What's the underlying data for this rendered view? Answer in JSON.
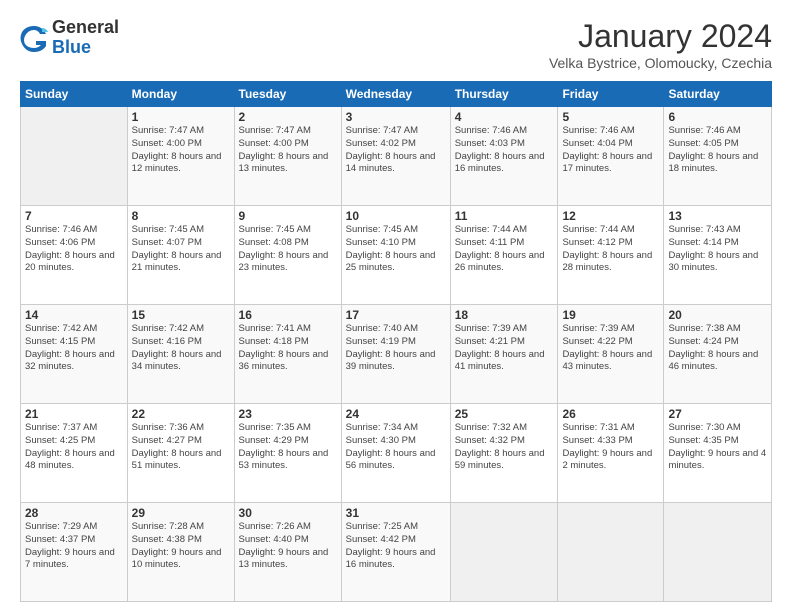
{
  "header": {
    "logo": {
      "general": "General",
      "blue": "Blue"
    },
    "title": "January 2024",
    "subtitle": "Velka Bystrice, Olomoucky, Czechia"
  },
  "weekdays": [
    "Sunday",
    "Monday",
    "Tuesday",
    "Wednesday",
    "Thursday",
    "Friday",
    "Saturday"
  ],
  "weeks": [
    [
      {
        "day": "",
        "sunrise": "",
        "sunset": "",
        "daylight": ""
      },
      {
        "day": "1",
        "sunrise": "Sunrise: 7:47 AM",
        "sunset": "Sunset: 4:00 PM",
        "daylight": "Daylight: 8 hours and 12 minutes."
      },
      {
        "day": "2",
        "sunrise": "Sunrise: 7:47 AM",
        "sunset": "Sunset: 4:00 PM",
        "daylight": "Daylight: 8 hours and 13 minutes."
      },
      {
        "day": "3",
        "sunrise": "Sunrise: 7:47 AM",
        "sunset": "Sunset: 4:02 PM",
        "daylight": "Daylight: 8 hours and 14 minutes."
      },
      {
        "day": "4",
        "sunrise": "Sunrise: 7:46 AM",
        "sunset": "Sunset: 4:03 PM",
        "daylight": "Daylight: 8 hours and 16 minutes."
      },
      {
        "day": "5",
        "sunrise": "Sunrise: 7:46 AM",
        "sunset": "Sunset: 4:04 PM",
        "daylight": "Daylight: 8 hours and 17 minutes."
      },
      {
        "day": "6",
        "sunrise": "Sunrise: 7:46 AM",
        "sunset": "Sunset: 4:05 PM",
        "daylight": "Daylight: 8 hours and 18 minutes."
      }
    ],
    [
      {
        "day": "7",
        "sunrise": "Sunrise: 7:46 AM",
        "sunset": "Sunset: 4:06 PM",
        "daylight": "Daylight: 8 hours and 20 minutes."
      },
      {
        "day": "8",
        "sunrise": "Sunrise: 7:45 AM",
        "sunset": "Sunset: 4:07 PM",
        "daylight": "Daylight: 8 hours and 21 minutes."
      },
      {
        "day": "9",
        "sunrise": "Sunrise: 7:45 AM",
        "sunset": "Sunset: 4:08 PM",
        "daylight": "Daylight: 8 hours and 23 minutes."
      },
      {
        "day": "10",
        "sunrise": "Sunrise: 7:45 AM",
        "sunset": "Sunset: 4:10 PM",
        "daylight": "Daylight: 8 hours and 25 minutes."
      },
      {
        "day": "11",
        "sunrise": "Sunrise: 7:44 AM",
        "sunset": "Sunset: 4:11 PM",
        "daylight": "Daylight: 8 hours and 26 minutes."
      },
      {
        "day": "12",
        "sunrise": "Sunrise: 7:44 AM",
        "sunset": "Sunset: 4:12 PM",
        "daylight": "Daylight: 8 hours and 28 minutes."
      },
      {
        "day": "13",
        "sunrise": "Sunrise: 7:43 AM",
        "sunset": "Sunset: 4:14 PM",
        "daylight": "Daylight: 8 hours and 30 minutes."
      }
    ],
    [
      {
        "day": "14",
        "sunrise": "Sunrise: 7:42 AM",
        "sunset": "Sunset: 4:15 PM",
        "daylight": "Daylight: 8 hours and 32 minutes."
      },
      {
        "day": "15",
        "sunrise": "Sunrise: 7:42 AM",
        "sunset": "Sunset: 4:16 PM",
        "daylight": "Daylight: 8 hours and 34 minutes."
      },
      {
        "day": "16",
        "sunrise": "Sunrise: 7:41 AM",
        "sunset": "Sunset: 4:18 PM",
        "daylight": "Daylight: 8 hours and 36 minutes."
      },
      {
        "day": "17",
        "sunrise": "Sunrise: 7:40 AM",
        "sunset": "Sunset: 4:19 PM",
        "daylight": "Daylight: 8 hours and 39 minutes."
      },
      {
        "day": "18",
        "sunrise": "Sunrise: 7:39 AM",
        "sunset": "Sunset: 4:21 PM",
        "daylight": "Daylight: 8 hours and 41 minutes."
      },
      {
        "day": "19",
        "sunrise": "Sunrise: 7:39 AM",
        "sunset": "Sunset: 4:22 PM",
        "daylight": "Daylight: 8 hours and 43 minutes."
      },
      {
        "day": "20",
        "sunrise": "Sunrise: 7:38 AM",
        "sunset": "Sunset: 4:24 PM",
        "daylight": "Daylight: 8 hours and 46 minutes."
      }
    ],
    [
      {
        "day": "21",
        "sunrise": "Sunrise: 7:37 AM",
        "sunset": "Sunset: 4:25 PM",
        "daylight": "Daylight: 8 hours and 48 minutes."
      },
      {
        "day": "22",
        "sunrise": "Sunrise: 7:36 AM",
        "sunset": "Sunset: 4:27 PM",
        "daylight": "Daylight: 8 hours and 51 minutes."
      },
      {
        "day": "23",
        "sunrise": "Sunrise: 7:35 AM",
        "sunset": "Sunset: 4:29 PM",
        "daylight": "Daylight: 8 hours and 53 minutes."
      },
      {
        "day": "24",
        "sunrise": "Sunrise: 7:34 AM",
        "sunset": "Sunset: 4:30 PM",
        "daylight": "Daylight: 8 hours and 56 minutes."
      },
      {
        "day": "25",
        "sunrise": "Sunrise: 7:32 AM",
        "sunset": "Sunset: 4:32 PM",
        "daylight": "Daylight: 8 hours and 59 minutes."
      },
      {
        "day": "26",
        "sunrise": "Sunrise: 7:31 AM",
        "sunset": "Sunset: 4:33 PM",
        "daylight": "Daylight: 9 hours and 2 minutes."
      },
      {
        "day": "27",
        "sunrise": "Sunrise: 7:30 AM",
        "sunset": "Sunset: 4:35 PM",
        "daylight": "Daylight: 9 hours and 4 minutes."
      }
    ],
    [
      {
        "day": "28",
        "sunrise": "Sunrise: 7:29 AM",
        "sunset": "Sunset: 4:37 PM",
        "daylight": "Daylight: 9 hours and 7 minutes."
      },
      {
        "day": "29",
        "sunrise": "Sunrise: 7:28 AM",
        "sunset": "Sunset: 4:38 PM",
        "daylight": "Daylight: 9 hours and 10 minutes."
      },
      {
        "day": "30",
        "sunrise": "Sunrise: 7:26 AM",
        "sunset": "Sunset: 4:40 PM",
        "daylight": "Daylight: 9 hours and 13 minutes."
      },
      {
        "day": "31",
        "sunrise": "Sunrise: 7:25 AM",
        "sunset": "Sunset: 4:42 PM",
        "daylight": "Daylight: 9 hours and 16 minutes."
      },
      {
        "day": "",
        "sunrise": "",
        "sunset": "",
        "daylight": ""
      },
      {
        "day": "",
        "sunrise": "",
        "sunset": "",
        "daylight": ""
      },
      {
        "day": "",
        "sunrise": "",
        "sunset": "",
        "daylight": ""
      }
    ]
  ]
}
